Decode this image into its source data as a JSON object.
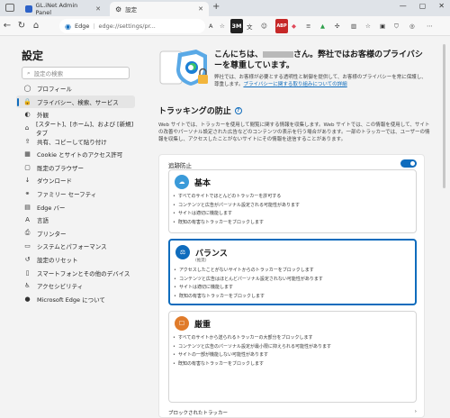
{
  "tabs": [
    {
      "title": "GL.iNet Admin Panel",
      "favicon_color": "#2d62c8"
    },
    {
      "title": "設定",
      "favicon_color": "#555555"
    }
  ],
  "address": {
    "edge_label": "Edge",
    "url": "edge://settings/pr..."
  },
  "extensions": [
    "3M",
    "ABP"
  ],
  "nav": {
    "title": "設定",
    "search_placeholder": "設定の検索",
    "items": [
      {
        "label": "プロフィール",
        "icon": "person-icon",
        "glyph": "◯"
      },
      {
        "label": "プライバシー、検索、サービス",
        "icon": "lock-icon",
        "glyph": "🔒"
      },
      {
        "label": "外観",
        "icon": "appearance-icon",
        "glyph": "◐"
      },
      {
        "label": "[スタート]、[ホーム]、および [新規] タブ",
        "icon": "home-icon",
        "glyph": "⌂"
      },
      {
        "label": "共有、コピーして貼り付け",
        "icon": "share-icon",
        "glyph": "⇪"
      },
      {
        "label": "Cookie とサイトのアクセス許可",
        "icon": "cookie-icon",
        "glyph": "▦"
      },
      {
        "label": "既定のブラウザー",
        "icon": "browser-icon",
        "glyph": "▢"
      },
      {
        "label": "ダウンロード",
        "icon": "download-icon",
        "glyph": "↓"
      },
      {
        "label": "ファミリー セーフティ",
        "icon": "family-icon",
        "glyph": "⚭"
      },
      {
        "label": "Edge バー",
        "icon": "edge-bar-icon",
        "glyph": "▤"
      },
      {
        "label": "言語",
        "icon": "language-icon",
        "glyph": "A"
      },
      {
        "label": "プリンター",
        "icon": "printer-icon",
        "glyph": "⎙"
      },
      {
        "label": "システムとパフォーマンス",
        "icon": "system-icon",
        "glyph": "▭"
      },
      {
        "label": "設定のリセット",
        "icon": "reset-icon",
        "glyph": "↺"
      },
      {
        "label": "スマートフォンとその他のデバイス",
        "icon": "phone-icon",
        "glyph": "▯"
      },
      {
        "label": "アクセシビリティ",
        "icon": "accessibility-icon",
        "glyph": "♿"
      },
      {
        "label": "Microsoft Edge について",
        "icon": "edge-icon",
        "glyph": "●"
      }
    ],
    "active_index": 1
  },
  "hero": {
    "title_prefix": "こんにちは、",
    "title_suffix": "さん。弊社ではお客様のプライバシーを尊重しています。",
    "desc": "弊社では、お客様が必要とする透明性と制御を提供して、お客様のプライバシーを常に保護し、尊重します。",
    "link": "プライバシーに関する取り組みについての詳細"
  },
  "tracking": {
    "title": "トラッキングの防止",
    "desc": "Web サイトでは、トラッカーを使用して閲覧に関する情報を収集します。Web サイトでは、この情報を使用して、サイトの改善やパーソナル設定された広告などのコンテンツの表示を行う場合があります。一部のトラッカーでは、ユーザーの情報を収集し、アクセスしたことがないサイトにその情報を送信することがあります。",
    "toggle_label": "追跡防止",
    "toggle_on": true,
    "blocked_label": "ブロックされたトラッカー",
    "options": [
      {
        "title": "基本",
        "subtitle": "",
        "icon": "basic-icon",
        "color": "#3a9ad9",
        "selected": false,
        "bullets": [
          "すべてのサイトでほとんどのトラッカーを許可する",
          "コンテンツと広告がパーソナル設定される可能性があります",
          "サイトは適切に機能します",
          "既知の有害なトラッカーをブロックします"
        ]
      },
      {
        "title": "バランス",
        "subtitle": "(推奨)",
        "icon": "balanced-icon",
        "color": "#0f6cbd",
        "selected": true,
        "bullets": [
          "アクセスしたことがないサイトからのトラッカーをブロックします",
          "コンテンツと広告はほとんどパーソナル設定されない可能性があります",
          "サイトは適切に機能します",
          "既知の有害なトラッカーをブロックします"
        ]
      },
      {
        "title": "厳重",
        "subtitle": "",
        "icon": "strict-icon",
        "color": "#e07b2a",
        "selected": false,
        "bullets": [
          "すべてのサイトから送られるトラッカーの大部分をブロックします",
          "コンテンツと広告のパーソナル設定が最小限に抑えられる可能性があります",
          "サイトの一部が機能しない可能性があります",
          "既知の有害なトラッカーをブロックします"
        ]
      }
    ]
  }
}
